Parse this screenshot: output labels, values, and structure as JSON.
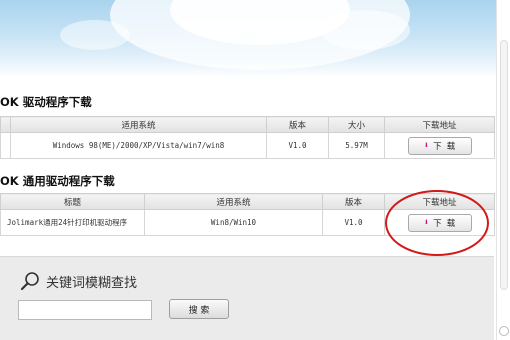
{
  "section1": {
    "title": "OK 驱动程序下载",
    "headers": [
      "",
      "适用系统",
      "版本",
      "大小",
      "下载地址"
    ],
    "row": {
      "system": "Windows 98(ME)/2000/XP/Vista/win7/win8",
      "version": "V1.0",
      "size": "5.97M",
      "download_label": "下 载"
    }
  },
  "section2": {
    "title": "OK 通用驱动程序下载",
    "headers": [
      "标题",
      "适用系统",
      "版本",
      "下载地址"
    ],
    "row": {
      "title": "Jolimark通用24针打印机驱动程序",
      "system": "Win8/Win10",
      "version": "V1.0",
      "download_label": "下 载"
    }
  },
  "search": {
    "title": "关键词模糊查找",
    "input_value": "",
    "button_label": "搜 索"
  },
  "icons": {
    "download": "download-arrow-icon",
    "search": "magnifier-icon"
  },
  "colors": {
    "highlight_circle": "#d11a1a",
    "download_arrow": "#c8127a"
  }
}
